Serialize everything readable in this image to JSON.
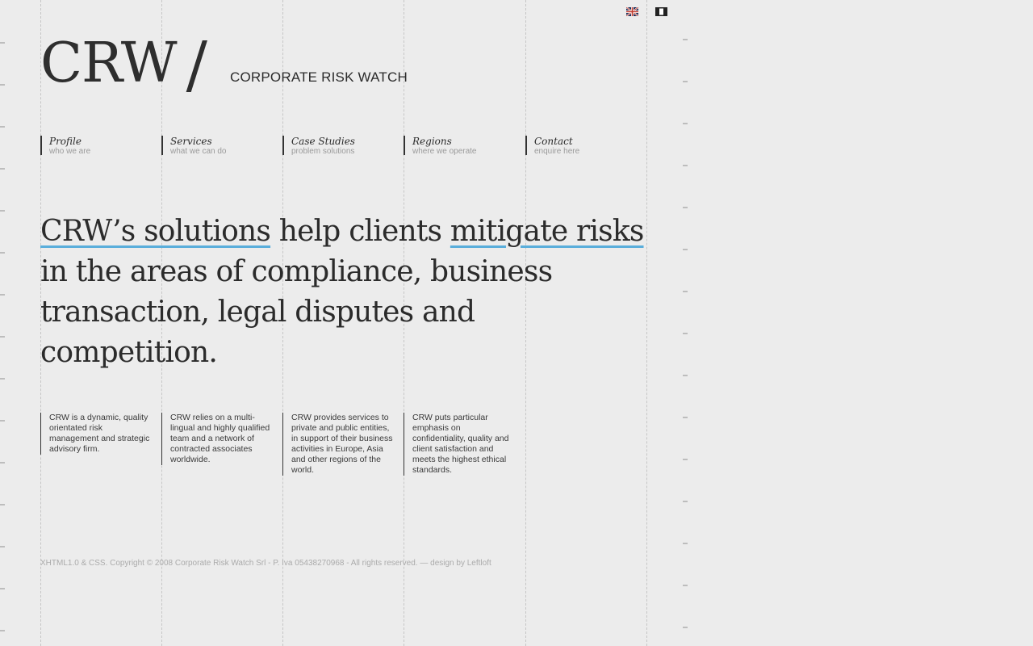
{
  "flags": {
    "english_icon": "uk-flag-icon",
    "italian_icon": "italy-flag-icon"
  },
  "logo": {
    "name": "CRW",
    "slash": "/",
    "tagline": "CORPORATE RISK WATCH"
  },
  "nav": [
    {
      "title": "Profile",
      "subtitle": "who we are"
    },
    {
      "title": "Services",
      "subtitle": "what we can do"
    },
    {
      "title": "Case Studies",
      "subtitle": "problem solutions"
    },
    {
      "title": "Regions",
      "subtitle": "where we operate"
    },
    {
      "title": "Contact",
      "subtitle": "enquire here"
    }
  ],
  "headline": {
    "part1": "CRW’s solutions",
    "part2": " help clients ",
    "part3": "mitigate risks",
    "part4": " in the areas of compliance, business transaction, legal disputes and competition."
  },
  "columns": [
    "CRW is a dynamic, quality orientated risk management and strategic advisory firm.",
    "CRW relies on a multi-lingual and highly qualified team and a network of contracted associates worldwide.",
    "CRW provides services to private and public entities, in support of their business activities in Europe, Asia and other regions of the world.",
    "CRW puts particular emphasis on confidentiality, quality and client satisfaction and meets the highest ethical standards."
  ],
  "footer": "XHTML1.0 & CSS. Copyright © 2008 Corporate Risk Watch Srl - P. Iva 05438270968 - All rights reserved. — design by Leftloft",
  "colors": {
    "background": "#ececec",
    "text": "#2b2b2b",
    "accent_underline": "#5aaedb",
    "muted": "#9a9a9a"
  }
}
